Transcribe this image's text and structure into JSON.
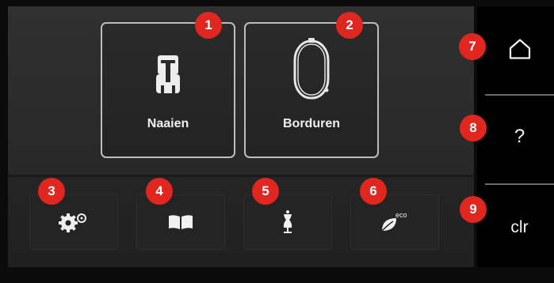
{
  "main": {
    "tiles": [
      {
        "label": "Naaien",
        "icon": "presser-foot-icon"
      },
      {
        "label": "Borduren",
        "icon": "embroidery-hoop-icon"
      }
    ],
    "bottom_buttons": [
      {
        "icon": "gears-icon"
      },
      {
        "icon": "open-book-icon"
      },
      {
        "icon": "dress-form-icon"
      },
      {
        "icon": "eco-leaf-icon",
        "sub_label": "eco"
      }
    ]
  },
  "sidebar": {
    "home_icon": "home-icon",
    "help_label": "?",
    "clear_label": "clr"
  },
  "badges": [
    "1",
    "2",
    "3",
    "4",
    "5",
    "6",
    "7",
    "8",
    "9"
  ],
  "colors": {
    "badge": "#e0261e",
    "tile_border": "#bdbdbd",
    "background": "#0b0b0b"
  }
}
